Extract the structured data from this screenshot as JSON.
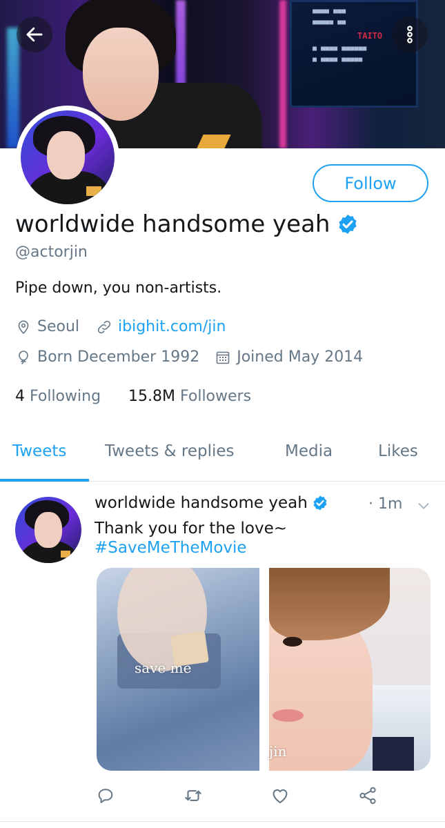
{
  "colors": {
    "accent": "#1da1f2",
    "secondary_text": "#657786",
    "primary_text": "#14171a"
  },
  "profile": {
    "display_name": "worldwide handsome yeah",
    "handle": "@actorjin",
    "bio": "Pipe down, you non-artists.",
    "location": "Seoul",
    "website": "ibighit.com/jin",
    "birthday": "Born December 1992",
    "joined": "Joined May 2014",
    "following_count": "4",
    "following_label": "Following",
    "followers_count": "15.8M",
    "followers_label": "Followers",
    "follow_button": "Follow",
    "verified_icon": "verified-badge-icon"
  },
  "tabs": [
    {
      "label": "Tweets",
      "active": true
    },
    {
      "label": "Tweets & replies",
      "active": false
    },
    {
      "label": "Media",
      "active": false
    },
    {
      "label": "Likes",
      "active": false
    }
  ],
  "tweet": {
    "author": "worldwide handsome yeah",
    "time": "· 1m",
    "text": "Thank you for the love~",
    "hashtag": "#SaveMeTheMovie",
    "media_caption_left": "save me",
    "media_caption_right": "jin",
    "actions": [
      "reply-icon",
      "retweet-icon",
      "like-icon",
      "share-icon"
    ]
  },
  "banner": {
    "screen_text": [
      "TAITO"
    ]
  }
}
